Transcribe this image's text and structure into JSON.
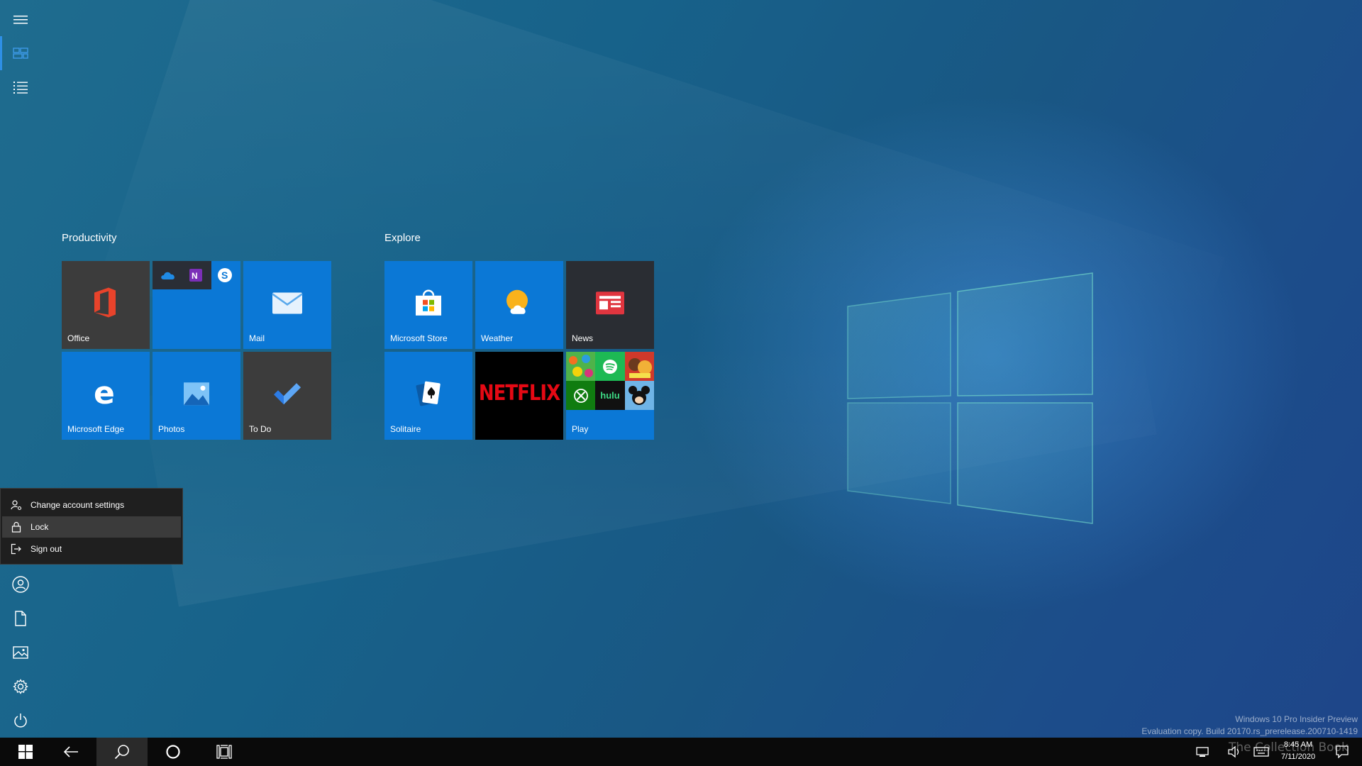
{
  "groups": {
    "productivity": {
      "title": "Productivity",
      "tiles": {
        "office": "Office",
        "mail": "Mail",
        "edge": "Microsoft Edge",
        "photos": "Photos",
        "todo": "To Do"
      }
    },
    "explore": {
      "title": "Explore",
      "tiles": {
        "store": "Microsoft Store",
        "weather": "Weather",
        "news": "News",
        "solitaire": "Solitaire",
        "netflix": "NETFLIX",
        "play": "Play"
      },
      "play_hulu": "hulu"
    }
  },
  "account_menu": {
    "items": [
      "Change account settings",
      "Lock",
      "Sign out"
    ],
    "highlighted": "Lock"
  },
  "taskbar": {
    "time": "8:45 AM",
    "date": "7/11/2020"
  },
  "watermark": {
    "line1": "Windows 10 Pro Insider Preview",
    "line2": "Evaluation copy. Build 20170.rs_prerelease.200710-1419"
  },
  "brand_overlay": "The Collection Book",
  "colors": {
    "tile_blue": "#0b78d6",
    "tile_dark": "#3c3c3c",
    "accent": "#2e8fe6"
  },
  "icons": {
    "rail": [
      "hamburger-icon",
      "tiles-view-icon",
      "list-view-icon",
      "user-icon",
      "document-icon",
      "pictures-icon",
      "settings-icon",
      "power-icon"
    ],
    "taskbar": [
      "windows-start-icon",
      "back-arrow-icon",
      "search-icon",
      "cortana-icon",
      "task-view-icon"
    ]
  }
}
